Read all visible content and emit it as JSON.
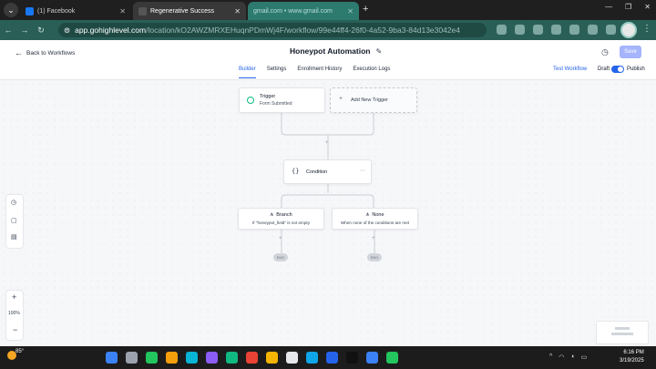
{
  "browser": {
    "tabs": [
      {
        "label": "(1) Facebook",
        "favicon_color": "#1877f2",
        "active": false
      },
      {
        "label": "Regenerative Success",
        "favicon_color": "#222222",
        "active": true
      },
      {
        "label": "gmail.com • www.gmail.com",
        "favicon_color": "#b7ded8",
        "active": false
      }
    ],
    "new_tab_label": "+",
    "window_controls": [
      "—",
      "❐",
      "✕"
    ],
    "url_host": "app.gohighlevel.com",
    "url_path": "/location/kO2AWZMRXEHuqnPDmWj4F/workflow/99e44ff4-26f0-4a52-9ba3-84d13e3042e4",
    "accent": "#2a5f58"
  },
  "header": {
    "back_label": "Back to Workflows",
    "title": "Honeypot Automation",
    "save_label": "Save",
    "tabs": [
      "Builder",
      "Settings",
      "Enrollment History",
      "Execution Logs"
    ],
    "active_tab": "Builder",
    "test_label": "Test Workflow",
    "draft_label": "Draft",
    "publish_label": "Publish",
    "publish_on": true
  },
  "canvas": {
    "trigger": {
      "label": "Trigger",
      "sub": "Form Submitted"
    },
    "add_trigger": "Add New Trigger",
    "condition": {
      "label": "Condition"
    },
    "branches": [
      {
        "label": "Branch",
        "desc": "If \"honeypot_field\" is not empty"
      },
      {
        "label": "None",
        "desc": "When none of the conditions are met"
      }
    ],
    "end_label": "END",
    "zoom_level": "100%"
  },
  "taskbar": {
    "temperature": "85°",
    "time": "6:16 PM",
    "date": "3/19/2025",
    "icon_colors": [
      "#3b82f6",
      "#9ca3af",
      "#22c55e",
      "#f59e0b",
      "#06b6d4",
      "#8b5cf6",
      "#10b981",
      "#ea4335",
      "#f4b400",
      "#e5e7eb",
      "#0ea5e9",
      "#2563eb",
      "#111111",
      "#3b82f6",
      "#22c55e"
    ]
  }
}
